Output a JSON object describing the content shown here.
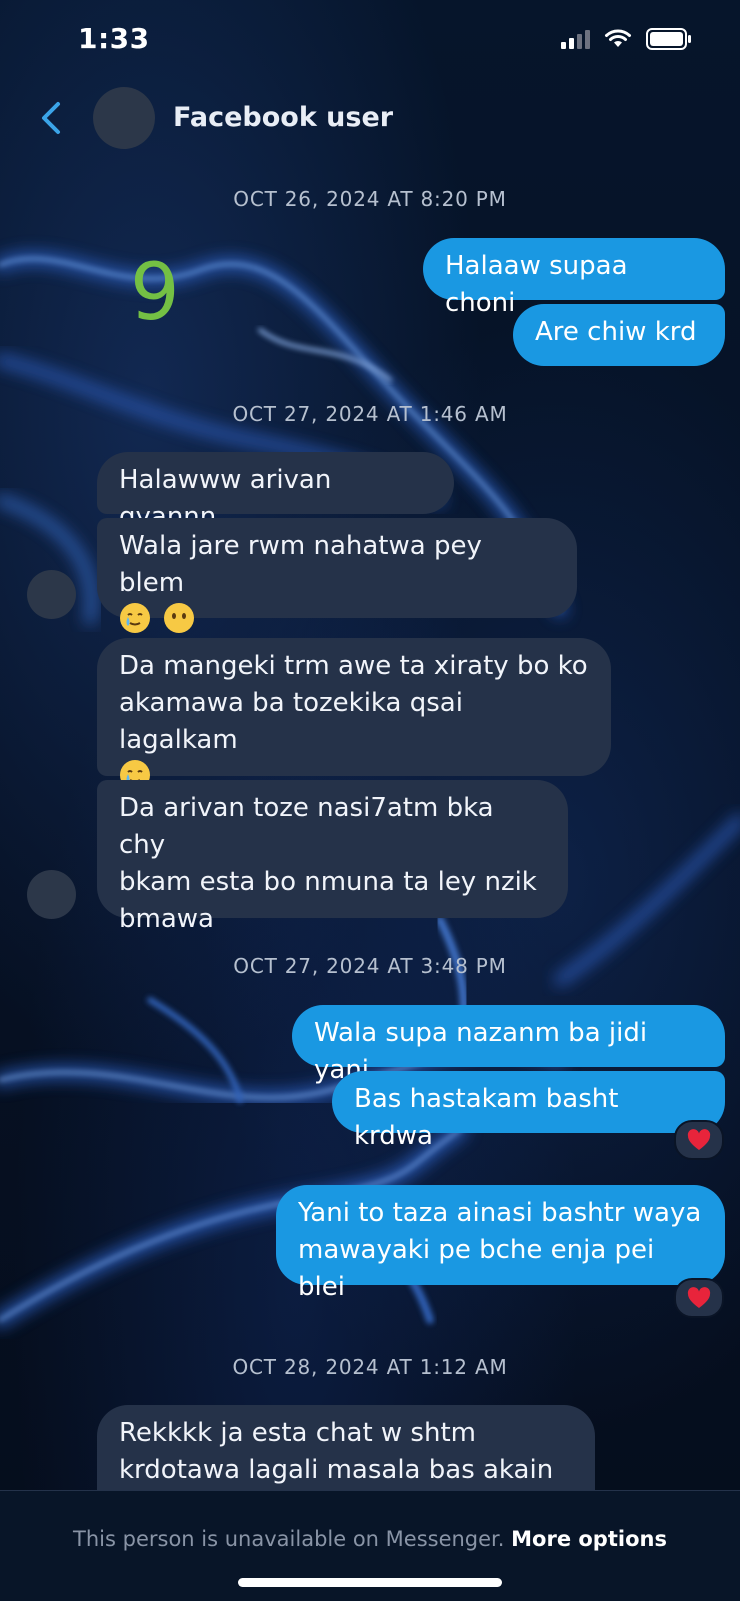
{
  "status": {
    "time": "1:33"
  },
  "header": {
    "contact_name": "Facebook user"
  },
  "overlay_number": "9",
  "timestamps": {
    "t1": "OCT 26, 2024 AT 8:20 PM",
    "t2": "OCT 27, 2024 AT 1:46 AM",
    "t3": "OCT 27, 2024 AT 3:48 PM",
    "t4": "OCT 28, 2024 AT 1:12 AM"
  },
  "messages": {
    "m1": "Halaaw supaa choni",
    "m2": "Are chiw krd",
    "m3": "Halawww arivan gyannn",
    "m4_line1": "Wala jare rwm nahatwa pey blem",
    "m5_line1": "Da mangeki trm awe ta xiraty bo ko",
    "m5_line2": "akamawa ba tozekika qsai lagalkam",
    "m6_line1": "Da arivan toze nasi7atm bka chy",
    "m6_line2": "bkam esta bo nmuna ta ley nzik",
    "m6_line3": "bmawa",
    "m7": "Wala supa nazanm ba jidi yani",
    "m8": "Bas hastakam basht krdwa",
    "m9_line1": "Yani to taza ainasi bashtr waya",
    "m9_line2": "mawayaki pe bche enja pei blei",
    "m10_line1": "Rekkkk ja esta chat w shtm",
    "m10_line2": "krdotawa lagali masala bas akain w"
  },
  "reactions": {
    "r1": "heart",
    "r2": "heart"
  },
  "footer": {
    "notice": "This person is unavailable on Messenger.",
    "link": "More options"
  },
  "colors": {
    "sent_bubble": "#1a98e2",
    "received_bubble": "#253249",
    "accent": "#1a98e2",
    "background": "#071326"
  }
}
